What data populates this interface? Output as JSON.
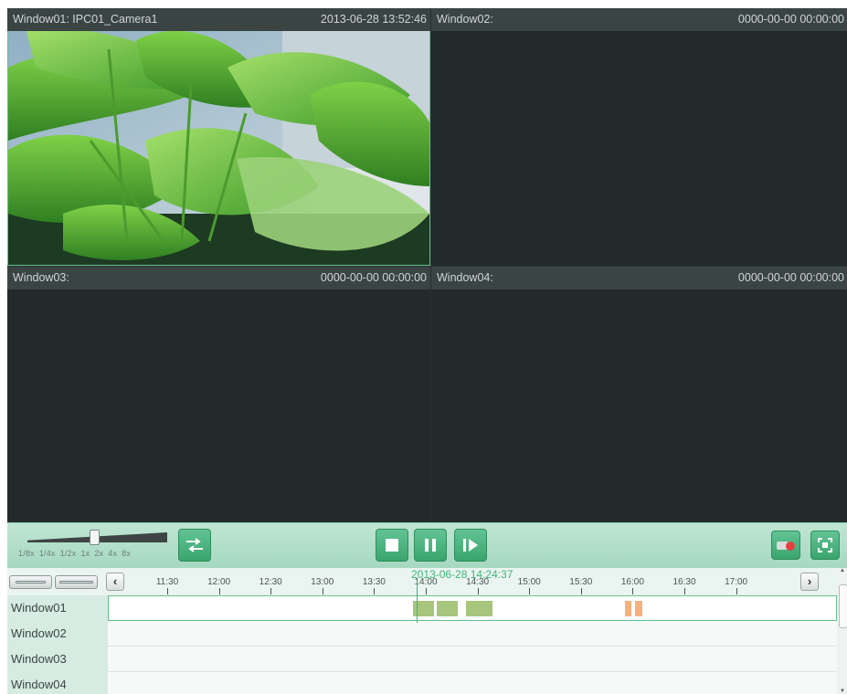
{
  "windows": [
    {
      "title": "Window01: IPC01_Camera1",
      "timestamp": "2013-06-28 13:52:46",
      "has_video": true
    },
    {
      "title": "Window02:",
      "timestamp": "0000-00-00 00:00:00",
      "has_video": false
    },
    {
      "title": "Window03:",
      "timestamp": "0000-00-00 00:00:00",
      "has_video": false
    },
    {
      "title": "Window04:",
      "timestamp": "0000-00-00 00:00:00",
      "has_video": false
    }
  ],
  "controls": {
    "speed_labels": [
      "1/8x",
      "1/4x",
      "1/2x",
      "1x",
      "2x",
      "4x",
      "8x"
    ],
    "speed_value": "1x",
    "sync_icon": "sync-arrows-icon",
    "stop_icon": "stop-icon",
    "pause_icon": "pause-icon",
    "step_icon": "frame-forward-icon",
    "capture_icon": "camera-record-icon",
    "fullscreen_icon": "fullscreen-icon"
  },
  "timeline": {
    "current_time": "2013-06-28 14:24:37",
    "ticks": [
      "11:30",
      "12:00",
      "12:30",
      "13:00",
      "13:30",
      "14:00",
      "14:30",
      "15:00",
      "15:30",
      "16:00",
      "16:30",
      "17:00"
    ],
    "prev_icon": "chevron-left-icon",
    "next_icon": "chevron-right-icon",
    "zoom_in_icon": "zoom-in-bar-icon",
    "zoom_out_icon": "zoom-out-bar-icon",
    "rows": [
      {
        "label": "Window01",
        "segments": [
          {
            "type": "green",
            "start": "13:52",
            "end": "14:04"
          },
          {
            "type": "green",
            "start": "14:06",
            "end": "14:18"
          },
          {
            "type": "green",
            "start": "14:23",
            "end": "14:38"
          },
          {
            "type": "orange",
            "start": "15:55",
            "end": "15:59"
          },
          {
            "type": "orange",
            "start": "16:01",
            "end": "16:05"
          }
        ]
      },
      {
        "label": "Window02",
        "segments": []
      },
      {
        "label": "Window03",
        "segments": []
      },
      {
        "label": "Window04",
        "segments": []
      }
    ]
  },
  "colors": {
    "accent": "#3fb67a",
    "record_normal": "#a8c57d",
    "record_event": "#f5b07c"
  }
}
